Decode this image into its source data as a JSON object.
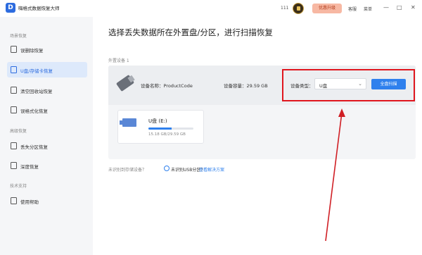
{
  "titlebar": {
    "app_title": "嗨格式数据恢复大师",
    "logo_glyph": "D",
    "count": "111",
    "upgrade": "优惠升级",
    "service": "客服",
    "menu": "菜单",
    "minimize": "—",
    "maximize": "□",
    "close": "✕"
  },
  "sidebar": {
    "section_scene": "场景恢复",
    "items_scene": [
      {
        "label": "误删除恢复",
        "icon": "file-icon"
      },
      {
        "label": "U盘/存储卡恢复",
        "icon": "usb-drive-icon",
        "active": true
      },
      {
        "label": "清空回收站恢复",
        "icon": "recycle-bin-icon"
      },
      {
        "label": "误格式化恢复",
        "icon": "format-icon"
      }
    ],
    "section_advanced": "高级恢复",
    "items_advanced": [
      {
        "label": "丢失分区恢复",
        "icon": "partition-icon"
      },
      {
        "label": "深度恢复",
        "icon": "deep-scan-icon"
      }
    ],
    "section_support": "技术支持",
    "items_support": [
      {
        "label": "使用帮助",
        "icon": "help-icon"
      }
    ]
  },
  "main": {
    "title": "选择丢失数据所在外置盘/分区，进行扫描恢复",
    "external_devices_label": "外置设备 1",
    "device": {
      "name": "设备名称：ProductCode",
      "capacity": "设备容量：29.59 GB",
      "type_label": "设备类型：",
      "type_value": "U盘",
      "scan_button": "全盘扫描"
    },
    "partition": {
      "title": "U盘 (E:)",
      "used_fraction": 0.51,
      "size": "15.18 GB/29.59 GB"
    },
    "footer": {
      "not_recognized": "未识别到存储设备？",
      "usb_partition": "未识别USB分区？",
      "solution_link": "查看解决方案"
    }
  },
  "colors": {
    "accent": "#2f80ed",
    "highlight": "#e0161e",
    "active_bg": "#dde9fb"
  }
}
